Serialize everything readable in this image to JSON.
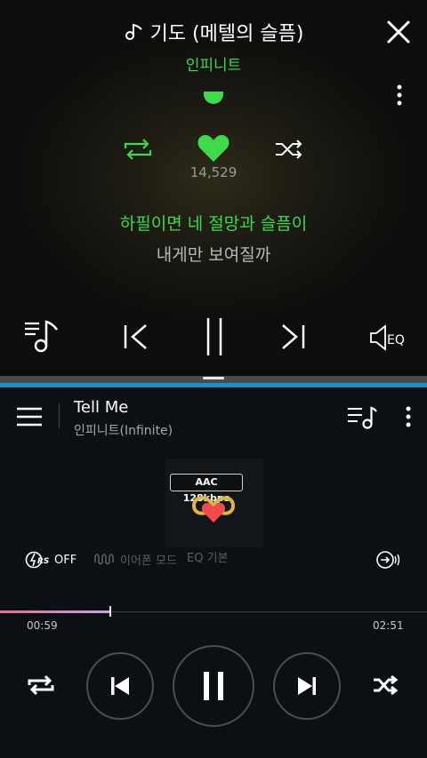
{
  "lyrics_view": {
    "song_title": "기도 (메텔의 슬픔)",
    "artist": "인피니트",
    "like_count": "14,529",
    "current_line": "하필이면 네 절망과 슬픔이",
    "next_line": "내게만 보여질까",
    "eq_label": "EQ"
  },
  "player": {
    "title": "Tell Me",
    "artist": "인피니트(Infinite)",
    "quality_badge": "AAC 128kbps",
    "rs_state": "OFF",
    "earphone_mode_label": "이어폰 모드",
    "eq_mode_label": "EQ 기본",
    "time_current": "00:59",
    "time_total": "02:51",
    "progress": 0.258
  },
  "colors": {
    "accent_green": "#3fd94c",
    "divider_blue": "#1e8fc2",
    "progress_pink": "#e0708a"
  },
  "icons": [
    "music-note-icon",
    "close-icon",
    "more-vert-icon",
    "repeat-icon",
    "heart-icon",
    "shuffle-icon",
    "playlist-icon",
    "previous-icon",
    "pause-icon",
    "next-icon",
    "equalizer-icon",
    "menu-icon",
    "rs-icon",
    "waveform-icon",
    "cast-icon"
  ]
}
